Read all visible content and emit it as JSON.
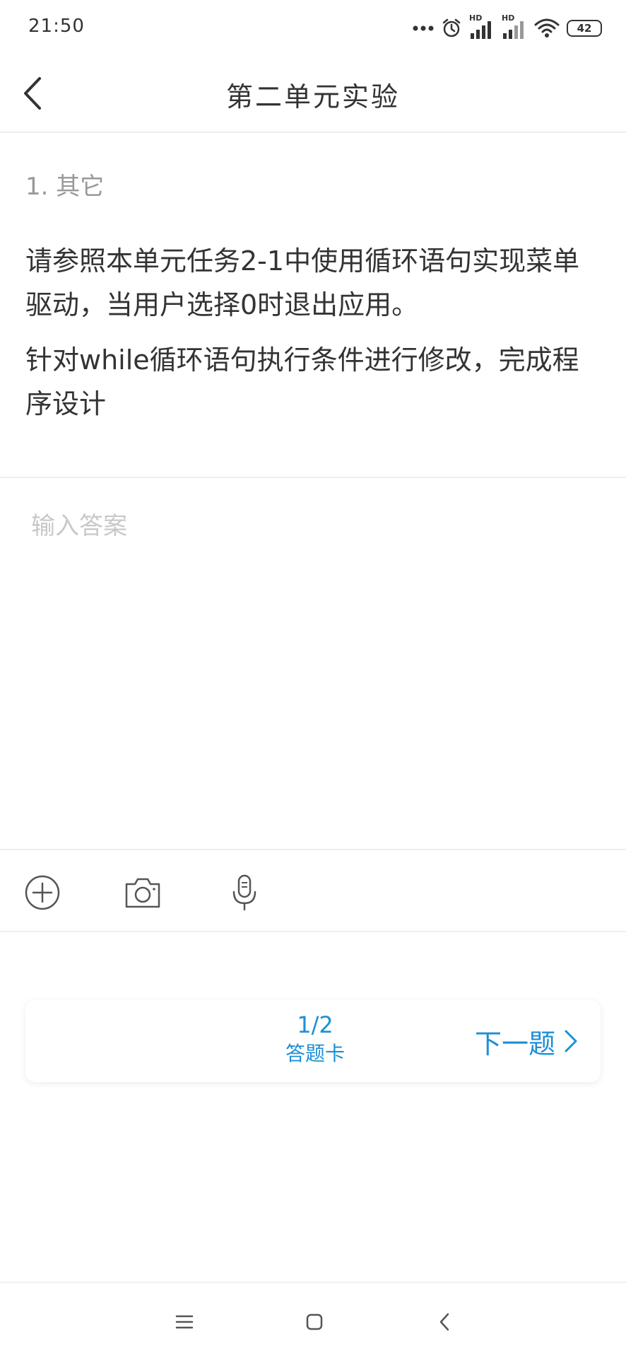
{
  "status_bar": {
    "time": "21:50",
    "battery": "42",
    "signal_label_1": "HD",
    "signal_label_2": "HD"
  },
  "header": {
    "title": "第二单元实验"
  },
  "question": {
    "number": "1. 其它",
    "paragraphs": [
      "请参照本单元任务2-1中使用循环语句实现菜单驱动，当用户选择0时退出应用。",
      "针对while循环语句执行条件进行修改，完成程序设计"
    ]
  },
  "answer": {
    "placeholder": "输入答案",
    "value": ""
  },
  "toolbar": {
    "icons": [
      "add-circle-icon",
      "camera-icon",
      "microphone-icon"
    ]
  },
  "footer_nav": {
    "progress": "1/2",
    "answer_card_label": "答题卡",
    "next_label": "下一题"
  },
  "colors": {
    "accent": "#1d8fd6",
    "text": "#333333",
    "muted": "#999999",
    "placeholder": "#c8c8c8",
    "divider": "#eeeeee"
  }
}
